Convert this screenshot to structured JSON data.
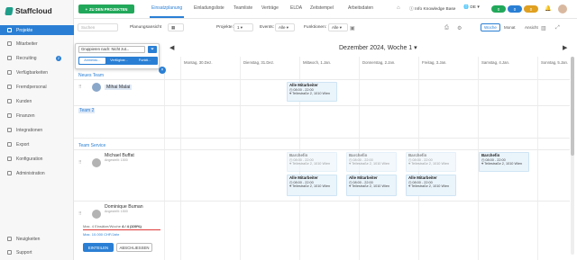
{
  "brand": {
    "name": "Staffcloud"
  },
  "sidebar": {
    "items": [
      {
        "label": "Projekte",
        "icon": "folder-icon"
      },
      {
        "label": "Mitarbeiter",
        "icon": "users-icon"
      },
      {
        "label": "Recruiting",
        "icon": "recruiting-icon",
        "badge": "2"
      },
      {
        "label": "Verfügbarkeiten",
        "icon": "calendar-icon"
      },
      {
        "label": "Fremdpersonal",
        "icon": "external-staff-icon"
      },
      {
        "label": "Kunden",
        "icon": "clients-icon"
      },
      {
        "label": "Finanzen",
        "icon": "finance-icon"
      },
      {
        "label": "Integrationen",
        "icon": "integrations-icon"
      },
      {
        "label": "Export",
        "icon": "export-icon"
      },
      {
        "label": "Konfiguration",
        "icon": "settings-icon"
      },
      {
        "label": "Administration",
        "icon": "admin-icon"
      }
    ],
    "bottom": [
      {
        "label": "Neuigkeiten",
        "icon": "news-icon"
      },
      {
        "label": "Support",
        "icon": "support-icon"
      }
    ]
  },
  "topbar": {
    "new_project": "ZU DEN PROJEKTEN",
    "tabs": [
      "Einsatzplanung",
      "Einladungsliste",
      "Teamliste",
      "Verträge",
      "ELDA",
      "Zeitstempel",
      "Arbeitsdaten"
    ],
    "info": "Info Knowledge Base",
    "lang": "DE",
    "pills": [
      "0",
      "0",
      "0"
    ]
  },
  "toolbar": {
    "search_placeholder": "Suchen",
    "planning_view_label": "Planungsansicht",
    "projects_label": "Projekte:",
    "projects_value": "1",
    "events_label": "Events:",
    "events_value": "Alle",
    "functions_label": "Funktionen:",
    "functions_value": "Alle",
    "views": [
      "Woche",
      "Monat",
      "Ansicht"
    ]
  },
  "popup": {
    "group_label": "Gruppieren nach: Nicht zut...",
    "tabs": [
      "Anmeldu...",
      "Verfügbar...",
      "Funkti..."
    ]
  },
  "calendar": {
    "title": "Dezember 2024, Woche 1",
    "days": [
      "Montag, 30.Dez.",
      "Dienstag, 31.Dez.",
      "Mittwoch, 1.Jan.",
      "Donnerstag, 2.Jan.",
      "Freitag, 3.Jan.",
      "Samstag, 4.Jan.",
      "Sonntag, 5.Jan."
    ]
  },
  "sections": [
    {
      "title": "Neues Team"
    },
    {
      "title": "Team 2"
    },
    {
      "title": "Team Service"
    }
  ],
  "employees": [
    {
      "name": "Mihai Malai",
      "sub": ""
    },
    {
      "name": "Michael Buffat",
      "sub": "Angestellt: 1500"
    },
    {
      "name": "Dominique Buman",
      "sub": "Angestellt: 1500",
      "hours": "Max. 4 Einsätze/Woche",
      "ratio": "4 / 4 (100%)",
      "hours2": "Max. 10.000 CHF/Jahr"
    }
  ],
  "cards": {
    "mihai": {
      "title": "Alle Mitarbeiter",
      "time": "08:00 - 22:00",
      "place": "Teilestraße 2, 1010 Wien"
    },
    "buffat": [
      {
        "title": "Barchefin",
        "time": "08:00 - 22:00",
        "place": "Teilestraße 2, 1010 Wien"
      },
      {
        "title": "Alle Mitarbeiter",
        "time": "08:00 - 22:00",
        "place": "Teilestraße 2, 1010 Wien"
      }
    ]
  },
  "footer": {
    "primary": "EINTEILEN",
    "secondary": "ABSCHLIESSEN"
  }
}
